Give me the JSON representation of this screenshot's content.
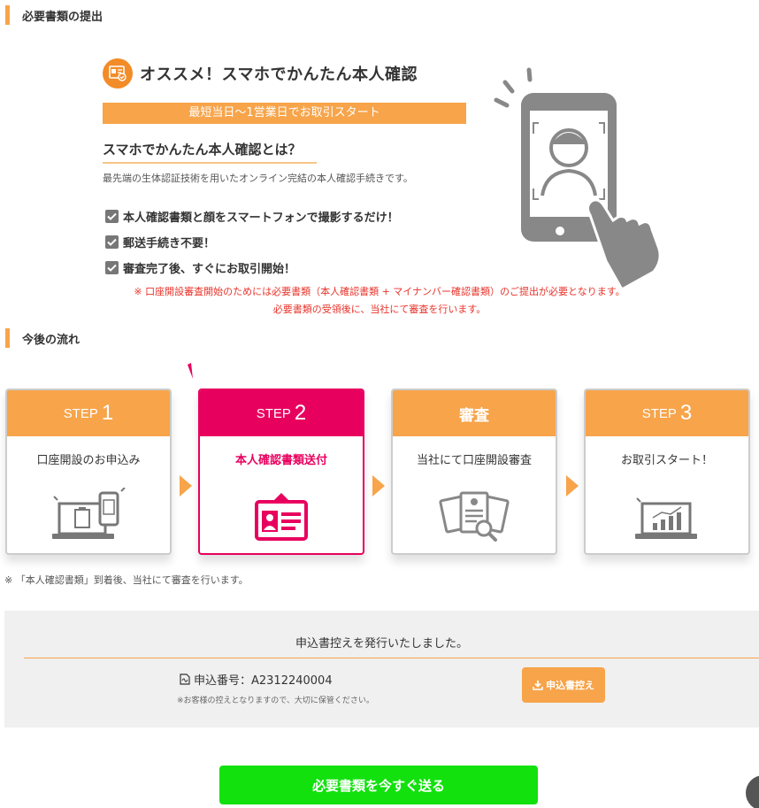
{
  "sections": {
    "submit_docs": "必要書類の提出",
    "flow": "今後の流れ"
  },
  "promo": {
    "title": "オススメ！スマホでかんたん本人確認",
    "band": "最短当日〜1営業日でお取引スタート",
    "what_title": "スマホでかんたん本人確認とは？",
    "description": "最先端の生体認証技術を用いたオンライン完結の本人確認手続きです。",
    "checks": [
      "本人確認書類と顔をスマートフォンで撮影するだけ！",
      "郵送手続き不要！",
      "審査完了後、すぐにお取引開始！"
    ]
  },
  "notice": {
    "line1": "※ 口座開設審査開始のためには必要書類（本人確認書類 + マイナンバー確認書類）のご提出が必要となります。",
    "line2": "必要書類の受領後に、当社にて審査を行います。"
  },
  "steps": [
    {
      "prefix": "STEP",
      "num": "1",
      "body": "口座開設のお申込み",
      "icon": "laptop-phone-icon",
      "active": false
    },
    {
      "prefix": "STEP",
      "num": "2",
      "body": "本人確認書類送付",
      "icon": "id-card-icon",
      "active": true
    },
    {
      "prefix": "",
      "num": "",
      "label": "審査",
      "body": "当社にて口座開設審査",
      "icon": "document-review-icon",
      "active": false
    },
    {
      "prefix": "STEP",
      "num": "3",
      "body": "お取引スタート！",
      "icon": "chart-laptop-icon",
      "active": false
    }
  ],
  "flow_note": "※ 「本人確認書類」到着後、当社にて審査を行います。",
  "receipt": {
    "message": "申込書控えを発行いたしました。",
    "app_label": "申込番号：A2312240004",
    "keep_note": "※お客様の控えとなりますので、大切に保管ください。",
    "download_label": "申込書控え"
  },
  "cta": {
    "send_label": "必要書類を今すぐ送る"
  },
  "colors": {
    "orange": "#f7a44a",
    "pink": "#e8005e",
    "green": "#12e10e",
    "red": "#e8332a"
  }
}
